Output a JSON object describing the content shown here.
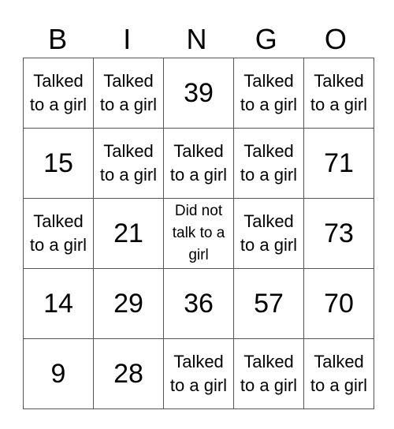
{
  "header": [
    "B",
    "I",
    "N",
    "G",
    "O"
  ],
  "rows": [
    [
      "Talked to a girl",
      "Talked to a girl",
      "39",
      "Talked to a girl",
      "Talked to a girl"
    ],
    [
      "15",
      "Talked to a girl",
      "Talked to a girl",
      "Talked to a girl",
      "71"
    ],
    [
      "Talked to a girl",
      "21",
      "Did not talk to a girl",
      "Talked to a girl",
      "73"
    ],
    [
      "14",
      "29",
      "36",
      "57",
      "70"
    ],
    [
      "9",
      "28",
      "Talked to a girl",
      "Talked to a girl",
      "Talked to a girl"
    ]
  ]
}
